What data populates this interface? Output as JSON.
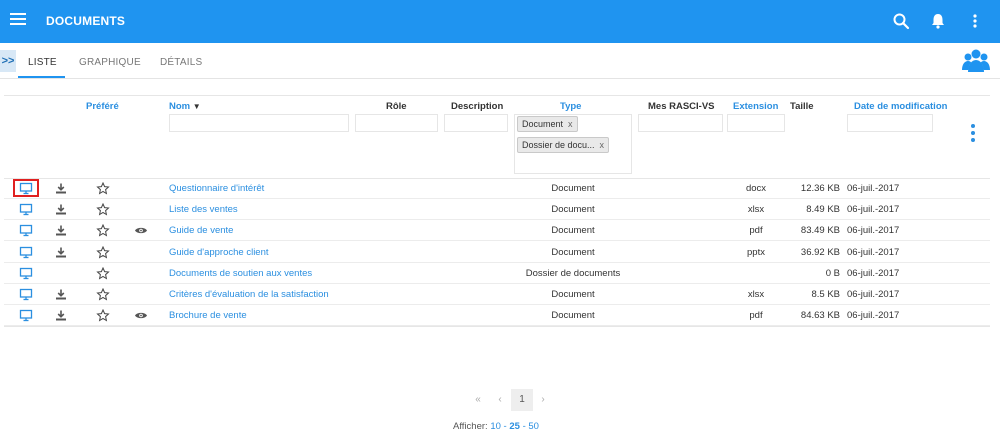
{
  "header": {
    "title": "DOCUMENTS",
    "bar_color": "#1f94f0",
    "icons": [
      "menu-icon",
      "search-icon",
      "bell-icon",
      "more-vertical-icon"
    ]
  },
  "tabs": {
    "expander": ">>",
    "items": [
      {
        "label": "LISTE",
        "active": true
      },
      {
        "label": "GRAPHIQUE",
        "active": false
      },
      {
        "label": "DÉTAILS",
        "active": false
      }
    ],
    "users_icon": "users-icon"
  },
  "grid": {
    "columns": {
      "favorite": "Préféré",
      "name": "Nom",
      "name_sort": "▼",
      "role": "Rôle",
      "description": "Description",
      "type": "Type",
      "rasci": "Mes RASCI-VS",
      "extension": "Extension",
      "size": "Taille",
      "modified": "Date de modification"
    },
    "type_filter_chips": [
      {
        "label": "Document",
        "remove": "x"
      },
      {
        "label": "Dossier de docu...",
        "remove": "x"
      }
    ],
    "rows": [
      {
        "name": "Questionnaire d'intérêt",
        "type": "Document",
        "extension": "docx",
        "size": "12.36 KB",
        "date": "06-juil.-2017",
        "download": true,
        "preview": false,
        "highlighted": true
      },
      {
        "name": "Liste des ventes",
        "type": "Document",
        "extension": "xlsx",
        "size": "8.49 KB",
        "date": "06-juil.-2017",
        "download": true,
        "preview": false,
        "highlighted": false
      },
      {
        "name": "Guide de vente",
        "type": "Document",
        "extension": "pdf",
        "size": "83.49 KB",
        "date": "06-juil.-2017",
        "download": true,
        "preview": true,
        "highlighted": false
      },
      {
        "name": "Guide d'approche client",
        "type": "Document",
        "extension": "pptx",
        "size": "36.92 KB",
        "date": "06-juil.-2017",
        "download": true,
        "preview": false,
        "highlighted": false
      },
      {
        "name": "Documents de soutien aux ventes",
        "type": "Dossier de documents",
        "extension": "",
        "size": "0 B",
        "date": "06-juil.-2017",
        "download": false,
        "preview": false,
        "highlighted": false
      },
      {
        "name": "Critères d'évaluation de la satisfaction",
        "type": "Document",
        "extension": "xlsx",
        "size": "8.5 KB",
        "date": "06-juil.-2017",
        "download": true,
        "preview": false,
        "highlighted": false
      },
      {
        "name": "Brochure de vente",
        "type": "Document",
        "extension": "pdf",
        "size": "84.63 KB",
        "date": "06-juil.-2017",
        "download": true,
        "preview": true,
        "highlighted": false
      }
    ]
  },
  "pagination": {
    "first": "«",
    "prev": "‹",
    "current_page": "1",
    "next": "›",
    "show_label": "Afficher:",
    "page_sizes": [
      "10",
      "25",
      "50"
    ],
    "separator": "-",
    "selected_size": "25"
  },
  "colors": {
    "accent": "#2b8fe0",
    "highlight_border": "#e02020"
  }
}
